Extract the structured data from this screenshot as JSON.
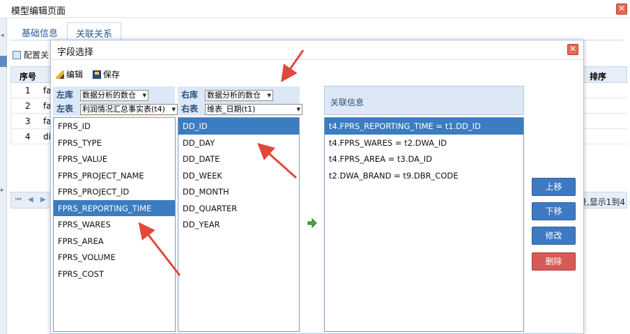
{
  "window": {
    "title": "模型编辑页面"
  },
  "tabs": [
    {
      "label": "基础信息"
    },
    {
      "label": "关联关系"
    }
  ],
  "outer_toolbar": {
    "config_label": "配置关"
  },
  "grid": {
    "headers": {
      "index": "序号",
      "sort": "排序"
    },
    "rows": [
      {
        "index": "1",
        "name": "fa"
      },
      {
        "index": "2",
        "name": "fa"
      },
      {
        "index": "3",
        "name": "fa"
      },
      {
        "index": "4",
        "name": "di"
      }
    ]
  },
  "pager": {
    "info": "录,显示1到4"
  },
  "dialog": {
    "title": "字段选择",
    "toolbar": {
      "edit": "编辑",
      "save": "保存"
    },
    "left": {
      "db_label": "左库",
      "db_value": "数据分析的数仓",
      "table_label": "左表",
      "table_value": "利润情况汇总事实表(t4)",
      "fields": [
        "FPRS_ID",
        "FPRS_TYPE",
        "FPRS_VALUE",
        "FPRS_PROJECT_NAME",
        "FPRS_PROJECT_ID",
        "FPRS_REPORTING_TIME",
        "FPRS_WARES",
        "FPRS_AREA",
        "FPRS_VOLUME",
        "FPRS_COST"
      ],
      "selected_index": 5
    },
    "right": {
      "db_label": "右库",
      "db_value": "数据分析的数仓",
      "table_label": "右表",
      "table_value": "维表_日期(t1)",
      "fields": [
        "DD_ID",
        "DD_DAY",
        "DD_DATE",
        "DD_WEEK",
        "DD_MONTH",
        "DD_QUARTER",
        "DD_YEAR"
      ],
      "selected_index": 0
    },
    "relation": {
      "header": "关联信息",
      "items": [
        "t4.FPRS_REPORTING_TIME = t1.DD_ID",
        "t4.FPRS_WARES = t2.DWA_ID",
        "t4.FPRS_AREA = t3.DA_ID",
        "t2.DWA_BRAND = t9.DBR_CODE"
      ],
      "selected_index": 0
    },
    "buttons": {
      "up": "上移",
      "down": "下移",
      "modify": "修改",
      "delete": "删除"
    }
  },
  "colors": {
    "selected": "#3c7cc0",
    "delete": "#d65a56",
    "annotation": "#e2483c"
  }
}
